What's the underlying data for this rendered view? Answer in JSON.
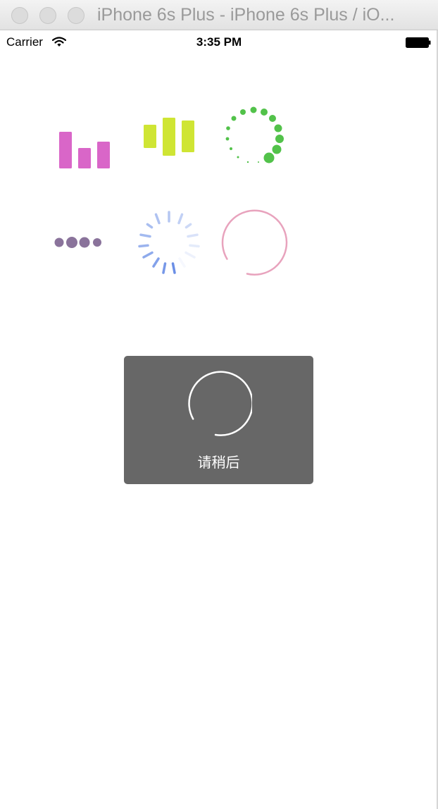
{
  "window": {
    "title": "iPhone 6s Plus - iPhone 6s Plus / iO..."
  },
  "status_bar": {
    "carrier": "Carrier",
    "time": "3:35 PM"
  },
  "hud": {
    "message": "请稍后"
  },
  "colors": {
    "bars_magenta": "#d966c8",
    "bars_lime": "#cfe534",
    "dots_green": "#52c24a",
    "dots_purple": "#8a739b",
    "spinner_blue": "#6b8fe6",
    "ring_pink": "#e8a3bd",
    "hud_background": "#676767"
  },
  "icons": {
    "status": [
      "wifi-icon",
      "battery-icon"
    ]
  }
}
